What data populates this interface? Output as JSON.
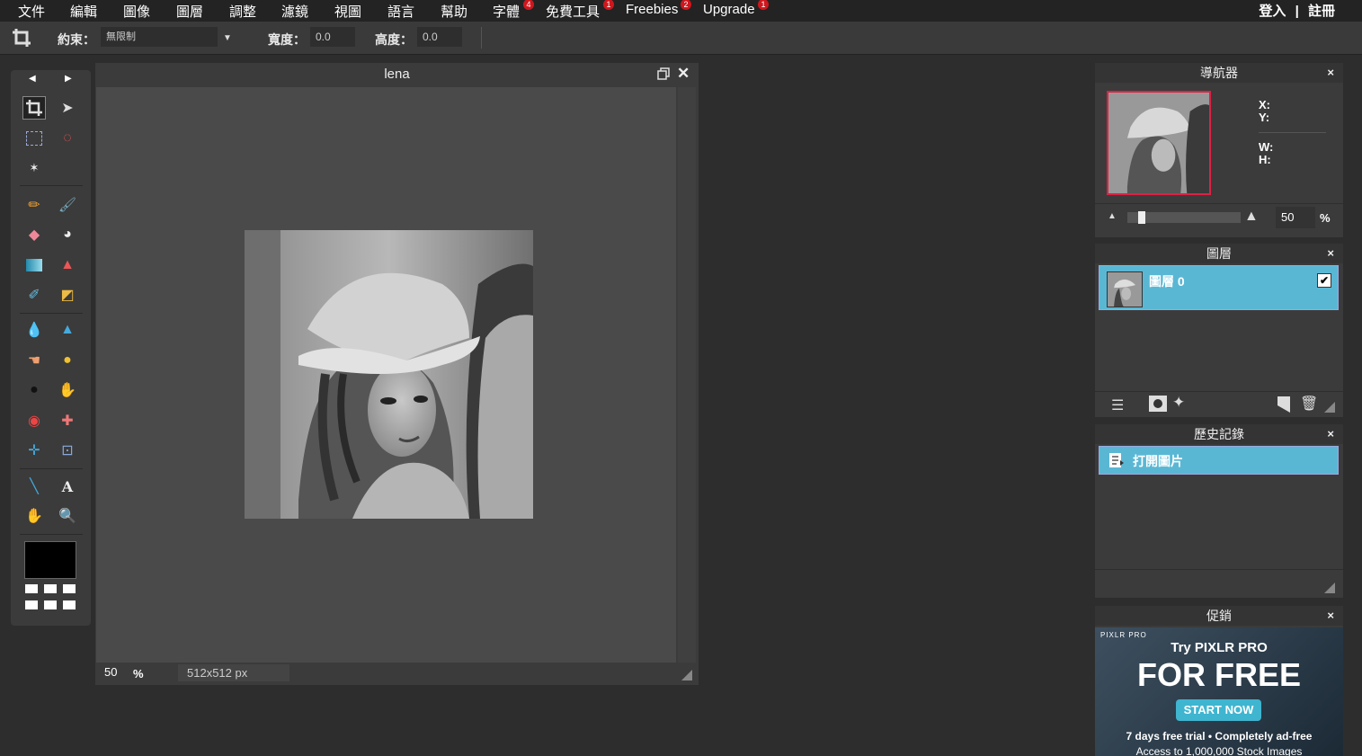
{
  "menu": {
    "items": [
      {
        "label": "文件"
      },
      {
        "label": "編輯"
      },
      {
        "label": "圖像"
      },
      {
        "label": "圖層"
      },
      {
        "label": "調整"
      },
      {
        "label": "濾鏡"
      },
      {
        "label": "視圖"
      },
      {
        "label": "語言"
      },
      {
        "label": "幫助"
      },
      {
        "label": "字體",
        "badge": "4"
      },
      {
        "label": "免費工具",
        "badge": "1"
      },
      {
        "label": "Freebies",
        "badge": "2"
      },
      {
        "label": "Upgrade",
        "badge": "1"
      }
    ],
    "login": "登入",
    "separator": "|",
    "register": "註冊"
  },
  "options": {
    "constraint_label": "約束：",
    "constraint_value": "無限制",
    "width_label": "寬度：",
    "width_value": "0.0",
    "height_label": "高度：",
    "height_value": "0.0"
  },
  "document": {
    "title": "lena",
    "zoom": "50",
    "zoom_unit": "%",
    "size": "512x512 px"
  },
  "navigator": {
    "title": "導航器",
    "close": "×",
    "x_label": "X:",
    "y_label": "Y:",
    "w_label": "W:",
    "h_label": "H:",
    "zoom": "50",
    "zoom_unit": "%"
  },
  "layers": {
    "title": "圖層",
    "close": "×",
    "items": [
      {
        "name": "圖層 0",
        "visible": true
      }
    ]
  },
  "history": {
    "title": "歷史記錄",
    "close": "×",
    "items": [
      {
        "label": "打開圖片"
      }
    ]
  },
  "promo": {
    "title": "促銷",
    "close": "×",
    "brand": "PIXLR PRO",
    "line1": "Try PIXLR PRO",
    "headline": "FOR FREE",
    "cta": "START NOW",
    "line2": "7 days free trial • Completely ad-free",
    "line3": "Access to 1,000,000 Stock Images"
  },
  "colors": {
    "selection": "#5ab7d4",
    "badge": "#d0161d",
    "background": "#2d2d2d"
  }
}
